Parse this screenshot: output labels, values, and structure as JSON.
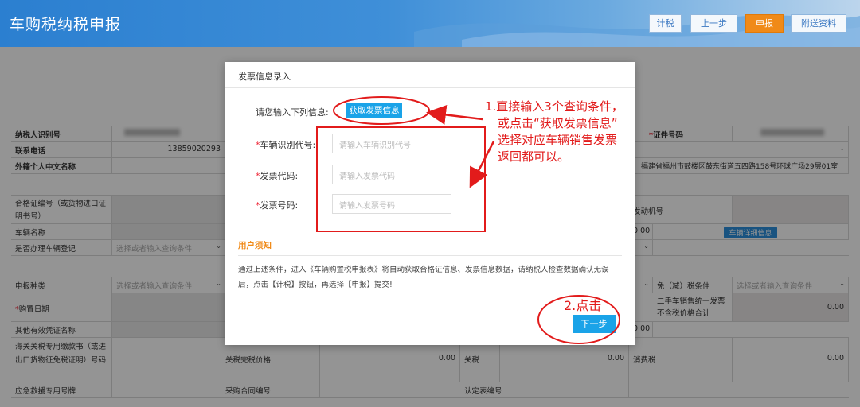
{
  "header": {
    "title": "车购税纳税申报",
    "buttons": [
      "计税",
      "上一步",
      "申报",
      "附送资料"
    ]
  },
  "form": {
    "taxpayer_id_label": "纳税人识别号",
    "phone_label": "联系电话",
    "phone_value": "13859020293",
    "foreign_name_label": "外籍个人中文名称",
    "id_number_label": "证件号码",
    "address_value": "福建省福州市鼓楼区鼓东街道五四路158号环球广场29层01室",
    "cert_label": "合格证编号（或货物进口证明书号）",
    "engine_label": "发动机号",
    "vehicle_name_label": "车辆名称",
    "vehicle_detail_btn": "车辆详细信息",
    "register_label": "是否办理车辆登记",
    "select_placeholder": "选择或者输入查询条件",
    "declare_type_label": "申报种类",
    "exempt_label": "免（减）税条件",
    "purchase_date_label": "购置日期",
    "used_car_label": "二手车销售统一发票不含税价格合计",
    "other_cert_label": "其他有效凭证名称",
    "customs_label": "海关关税专用缴款书（或进出口货物征免税证明）号码",
    "duty_paid_label": "关税完税价格",
    "tariff_label": "关税",
    "consumption_tax_label": "消费税",
    "emergency_label": "应急救援专用号牌",
    "contract_label": "采购合同编号",
    "confirm_label": "认定表编号",
    "zero": "0.00"
  },
  "modal": {
    "title": "发票信息录入",
    "prompt": "请您输入下列信息:",
    "fetch_button": "获取发票信息",
    "vin_label": "车辆识别代号:",
    "vin_placeholder": "请输入车辆识别代号",
    "invoice_code_label": "发票代码:",
    "invoice_code_placeholder": "请输入发票代码",
    "invoice_no_label": "发票号码:",
    "invoice_no_placeholder": "请输入发票号码",
    "notice_title": "用户须知",
    "notice_text": "通过上述条件，进入《车辆购置税申报表》将自动获取合格证信息、发票信息数据，请纳税人检查数据确认无误后，点击【计税】按钮，再选择【申报】提交!",
    "next_button": "下一步"
  },
  "annotations": {
    "note1_line1": "1.直接输入3个查询条件，",
    "note1_line2": "或点击“获取发票信息”",
    "note1_line3": "选择对应车辆销售发票",
    "note1_line4": "返回都可以。",
    "note2": "2.点击"
  },
  "colors": {
    "header_blue": "#2b7fd0",
    "accent_orange": "#f08a18",
    "button_blue": "#1aa3e8",
    "annotation_red": "#e21b1b"
  }
}
